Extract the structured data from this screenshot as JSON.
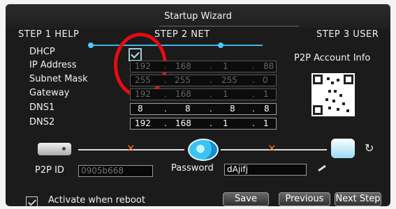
{
  "window": {
    "title": "Startup Wizard"
  },
  "steps": [
    {
      "label": "STEP 1 HELP"
    },
    {
      "label": "STEP 2 NET"
    },
    {
      "label": "STEP 3 USER"
    }
  ],
  "network": {
    "dhcp_label": "DHCP",
    "ip_label": "IP Address",
    "ip": [
      "192",
      ".",
      "168",
      ".",
      "1",
      ".",
      "88"
    ],
    "subnet_label": "Subnet Mask",
    "subnet": [
      "255",
      ".",
      "255",
      ".",
      "255",
      ".",
      "0"
    ],
    "gateway_label": "Gateway",
    "gateway": [
      "192",
      ".",
      "168",
      ".",
      "1",
      ".",
      "1"
    ],
    "dns1_label": "DNS1",
    "dns1": [
      "8",
      ".",
      "8",
      ".",
      "8",
      ".",
      "8"
    ],
    "dns2_label": "DNS2",
    "dns2": [
      "192",
      ".",
      "168",
      ".",
      "1",
      ".",
      "1"
    ]
  },
  "p2p": {
    "account_info": "P2P Account Info",
    "id_label": "P2P ID",
    "id_value": "0905b668",
    "password_label": "Password",
    "password_value": "dAjifj"
  },
  "bottom": {
    "activate_label": "Activate when reboot",
    "save": "Save",
    "previous": "Previous",
    "next_step": "Next Step"
  },
  "colors": {
    "highlight": "#e50b12",
    "accent": "#42b4e8"
  }
}
